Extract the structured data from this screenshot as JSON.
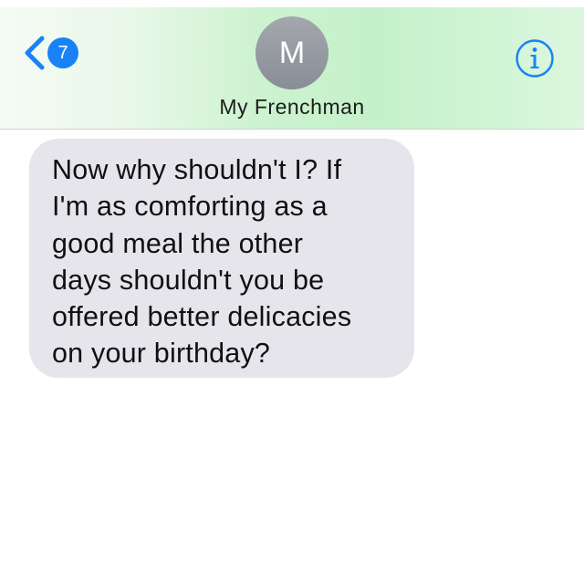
{
  "nav": {
    "back_badge": "7",
    "avatar_initial": "M",
    "contact_name": "My Frenchman",
    "icons": {
      "back": "chevron-left-icon",
      "info": "info-circle-icon"
    }
  },
  "message": {
    "direction": "received",
    "lines": [
      "Now why shouldn't I? If",
      "I'm as comforting as a",
      "good meal the other",
      "days shouldn't you be",
      "offered better delicacies",
      "on your birthday?"
    ]
  },
  "colors": {
    "accent": "#1a82f7",
    "received_bubble": "#e6e5eb",
    "avatar": "#9a9da4"
  }
}
